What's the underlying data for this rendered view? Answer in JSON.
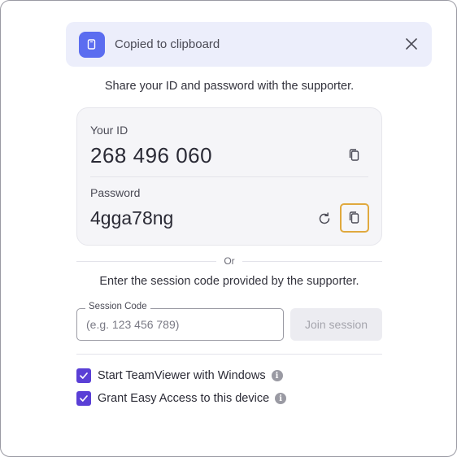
{
  "toast": {
    "message": "Copied to clipboard",
    "icon": "clipboard-icon",
    "close_icon": "close-icon",
    "accent_color": "#5b6df0"
  },
  "share_instruction": "Share your ID and password with the supporter.",
  "credentials": {
    "id_label": "Your ID",
    "id_value": "268 496 060",
    "password_label": "Password",
    "password_value": "4gga78ng"
  },
  "separator_text": "Or",
  "session": {
    "instruction": "Enter the session code provided by the supporter.",
    "field_label": "Session Code",
    "placeholder": "(e.g. 123 456 789)",
    "value": "",
    "join_label": "Join session"
  },
  "options": [
    {
      "label": "Start TeamViewer with Windows",
      "checked": true
    },
    {
      "label": "Grant Easy Access to this device",
      "checked": true
    }
  ],
  "colors": {
    "checkbox": "#5a3fd6",
    "focus_ring": "#e0a93e"
  }
}
